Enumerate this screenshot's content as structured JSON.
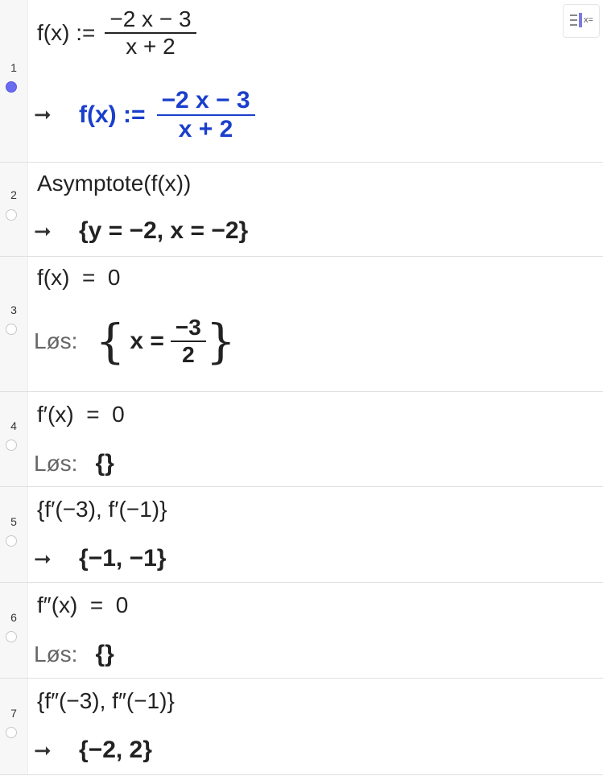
{
  "toolbar": {
    "toggle_label": "x=",
    "toggle_icon": "algebra-view-icon"
  },
  "rows": [
    {
      "num": "1",
      "input_prefix": "f(x) :=",
      "input_num": "−2 x − 3",
      "input_den": "x + 2",
      "arrow": "➞",
      "output_prefix": "f(x) :=",
      "output_num": "−2 x − 3",
      "output_den": "x + 2",
      "active": true
    },
    {
      "num": "2",
      "input": "Asymptote(f(x))",
      "arrow": "➞",
      "output": "{y = −2, x = −2}"
    },
    {
      "num": "3",
      "input": "f(x)  =  0",
      "solve_label": "Løs:",
      "output_lhs": "x =",
      "output_num": "−3",
      "output_den": "2"
    },
    {
      "num": "4",
      "input": "f′(x)  =  0",
      "solve_label": "Løs:",
      "output": "{}"
    },
    {
      "num": "5",
      "input": "{f′(−3), f′(−1)}",
      "arrow": "➞",
      "output": "{−1, −1}"
    },
    {
      "num": "6",
      "input": "f″(x)  =  0",
      "solve_label": "Løs:",
      "output": "{}"
    },
    {
      "num": "7",
      "input": "{f″(−3), f″(−1)}",
      "arrow": "➞",
      "output": "{−2, 2}"
    }
  ],
  "colors": {
    "accent": "#1a3fcc",
    "active_dot": "#6a6cf0",
    "gutter": "#f7f7f7"
  }
}
